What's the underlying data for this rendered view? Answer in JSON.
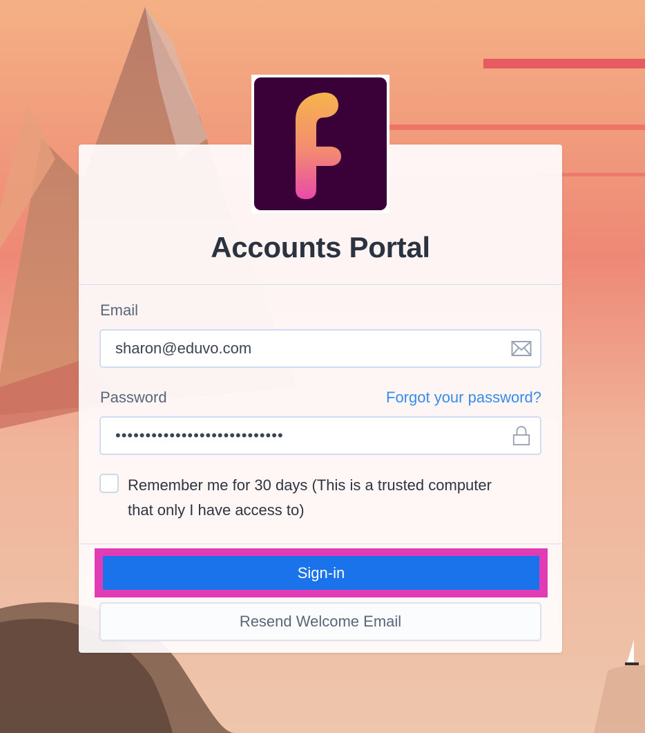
{
  "app": {
    "title": "Accounts Portal",
    "logo_icon": "letter-f-logo-icon"
  },
  "form": {
    "email_label": "Email",
    "email_value": "sharon@eduvo.com",
    "email_icon": "envelope-icon",
    "password_label": "Password",
    "password_value": "••••••••••••••••••••••••••••",
    "password_icon": "lock-icon",
    "forgot_link": "Forgot your password?",
    "remember_label": "Remember me for 30 days (This is a trusted computer that only I have access to)",
    "remember_checked": false,
    "signin_button": "Sign-in",
    "resend_button": "Resend Welcome Email"
  },
  "colors": {
    "primary": "#1a73ea",
    "link": "#3a8ae8",
    "highlight": "#e23bb6",
    "logo_bg": "#3a0038"
  }
}
